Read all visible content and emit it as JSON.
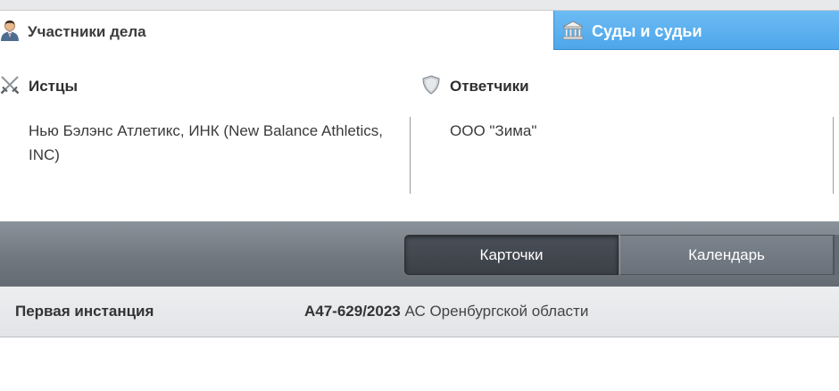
{
  "tabs": {
    "participants": {
      "label": "Участники дела",
      "icon": "person-icon"
    },
    "courts": {
      "label": "Суды и судьи",
      "icon": "courthouse-icon",
      "color": "#58aeee"
    }
  },
  "parties": {
    "plaintiffs": {
      "heading": "Истцы",
      "icon": "crossed-swords-icon",
      "items": [
        "Нью Бэлэнс Атлетикс, ИНК (New Balance Athletics, INC)"
      ]
    },
    "defendants": {
      "heading": "Ответчики",
      "icon": "shield-icon",
      "items": [
        "ООО \"Зима\""
      ]
    }
  },
  "toolbar": {
    "cards_label": "Карточки",
    "calendar_label": "Календарь",
    "active": "cards"
  },
  "instance": {
    "label": "Первая инстанция",
    "case_number": "А47-629/2023",
    "court": " АС Оренбургской области"
  }
}
